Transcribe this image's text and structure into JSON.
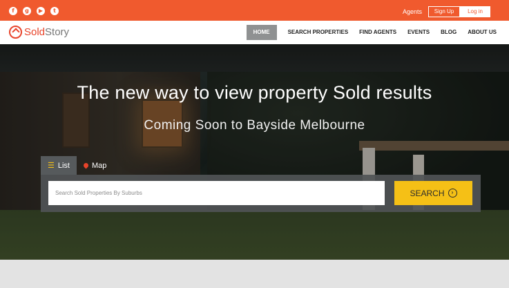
{
  "topbar": {
    "social": [
      "facebook-icon",
      "google-plus-icon",
      "youtube-icon",
      "twitter-icon"
    ],
    "agents": "Agents",
    "signup": "Sign Up",
    "login": "Log in"
  },
  "brand": {
    "part1": "Sold",
    "part2": "Story"
  },
  "nav": [
    "HOME",
    "SEARCH  PROPERTIES",
    "FIND AGENTS",
    "EVENTS",
    "BLOG",
    "ABOUT US"
  ],
  "hero": {
    "headline": "The new way to view property Sold results",
    "subhead": "Coming Soon to Bayside Melbourne"
  },
  "tabs": {
    "list": "List",
    "map": "Map"
  },
  "search": {
    "placeholder": "Search Sold Properties By Suburbs",
    "button": "SEARCH"
  },
  "colors": {
    "accent": "#f05a2e",
    "search_button": "#f5c016",
    "nav_active": "#8f9192"
  }
}
